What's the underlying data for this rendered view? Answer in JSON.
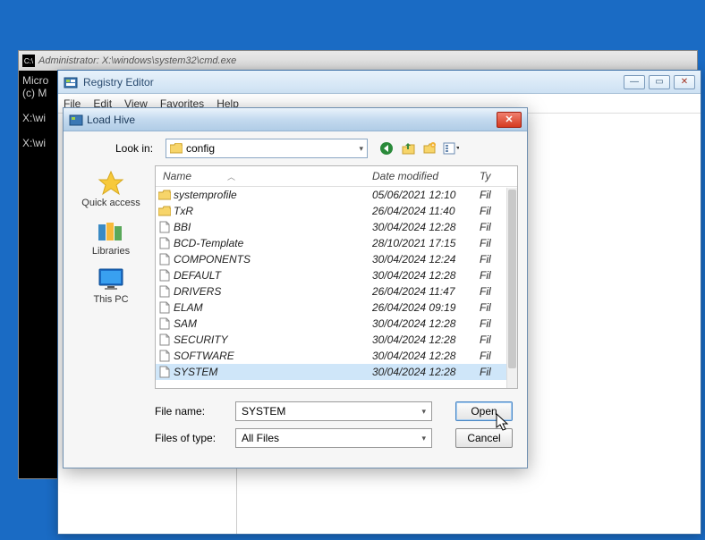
{
  "cmd": {
    "title": "Administrator: X:\\windows\\system32\\cmd.exe",
    "line1": "Micro",
    "line2": "(c) M",
    "line3": "X:\\wi",
    "line4": "X:\\wi"
  },
  "regedit": {
    "title": "Registry Editor",
    "menu": {
      "file": "File",
      "edit": "Edit",
      "view": "View",
      "favorites": "Favorites",
      "help": "Help"
    }
  },
  "dialog": {
    "title": "Load Hive",
    "lookin_label": "Look in:",
    "lookin_value": "config",
    "columns": {
      "name": "Name",
      "date": "Date modified",
      "type": "Ty"
    },
    "places": {
      "quick_access": "Quick access",
      "libraries": "Libraries",
      "this_pc": "This PC"
    },
    "files": [
      {
        "name": "systemprofile",
        "date": "05/06/2021 12:10",
        "type": "Fil",
        "kind": "folder"
      },
      {
        "name": "TxR",
        "date": "26/04/2024 11:40",
        "type": "Fil",
        "kind": "folder"
      },
      {
        "name": "BBI",
        "date": "30/04/2024 12:28",
        "type": "Fil",
        "kind": "file"
      },
      {
        "name": "BCD-Template",
        "date": "28/10/2021 17:15",
        "type": "Fil",
        "kind": "file"
      },
      {
        "name": "COMPONENTS",
        "date": "30/04/2024 12:24",
        "type": "Fil",
        "kind": "file"
      },
      {
        "name": "DEFAULT",
        "date": "30/04/2024 12:28",
        "type": "Fil",
        "kind": "file"
      },
      {
        "name": "DRIVERS",
        "date": "26/04/2024 11:47",
        "type": "Fil",
        "kind": "file"
      },
      {
        "name": "ELAM",
        "date": "26/04/2024 09:19",
        "type": "Fil",
        "kind": "file"
      },
      {
        "name": "SAM",
        "date": "30/04/2024 12:28",
        "type": "Fil",
        "kind": "file"
      },
      {
        "name": "SECURITY",
        "date": "30/04/2024 12:28",
        "type": "Fil",
        "kind": "file"
      },
      {
        "name": "SOFTWARE",
        "date": "30/04/2024 12:28",
        "type": "Fil",
        "kind": "file"
      },
      {
        "name": "SYSTEM",
        "date": "30/04/2024 12:28",
        "type": "Fil",
        "kind": "file",
        "selected": true
      }
    ],
    "filename_label": "File name:",
    "filename_value": "SYSTEM",
    "filetype_label": "Files of type:",
    "filetype_value": "All Files",
    "open_btn": "Open",
    "cancel_btn": "Cancel"
  }
}
